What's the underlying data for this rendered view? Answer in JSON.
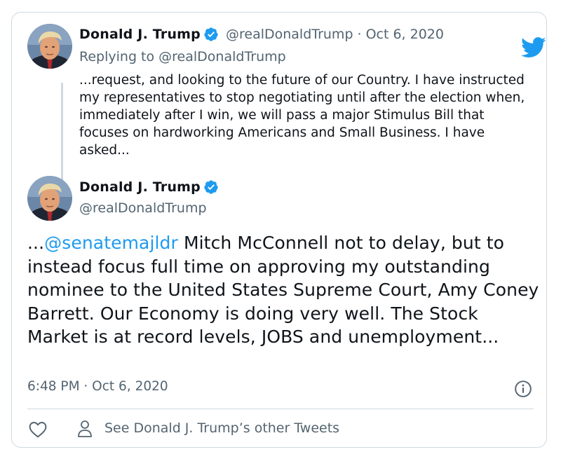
{
  "brand": {
    "accent": "#1d9bf0",
    "muted": "#536471",
    "border": "#cfd9de"
  },
  "parent_tweet": {
    "name": "Donald J. Trump",
    "handle": "@realDonaldTrump",
    "separator": "·",
    "date": "Oct 6, 2020",
    "replying_to": "Replying to @realDonaldTrump",
    "text": "...request, and looking to the future of our Country. I have instructed my representatives to stop negotiating until after the election when, immediately after I win, we will pass a major Stimulus Bill that focuses on hardworking Americans and Small Business. I have asked..."
  },
  "main_tweet": {
    "name": "Donald J. Trump",
    "handle": "@realDonaldTrump",
    "text_prefix": "...",
    "mention": "@senatemajldr",
    "text_rest": " Mitch McConnell not to delay, but to instead focus full time on approving my outstanding nominee to the United States Supreme Court, Amy Coney Barrett. Our Economy is doing very well. The Stock Market is at record levels, JOBS and unemployment...",
    "timestamp": "6:48 PM · Oct 6, 2020"
  },
  "footer": {
    "other_tweets_label": "See Donald J. Trump’s other Tweets"
  },
  "icons": {
    "logo": "twitter-bird-icon",
    "verified": "verified-badge-icon",
    "info": "info-icon",
    "like": "heart-icon",
    "profile": "person-icon"
  }
}
